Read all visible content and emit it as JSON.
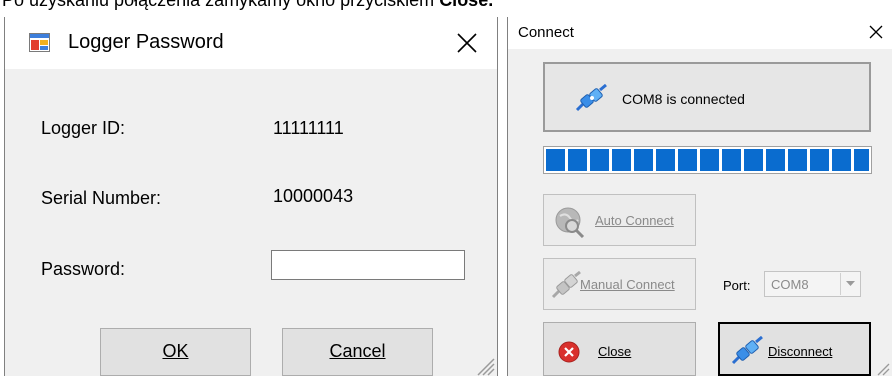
{
  "caption": {
    "text": "Po uzyskaniu połączenia zamykamy okno przyciskiem ",
    "bold": "Close."
  },
  "logger_dialog": {
    "title": "Logger Password",
    "logger_id_label": "Logger ID:",
    "logger_id_value": "11111111",
    "serial_label": "Serial Number:",
    "serial_value": "10000043",
    "password_label": "Password:",
    "password_value": "",
    "ok_label": "OK",
    "cancel_label": "Cancel"
  },
  "connect_dialog": {
    "title": "Connect",
    "status_text": "COM8 is connected",
    "progress_fraction": 1.0,
    "auto_connect_label": "Auto Connect",
    "manual_connect_label": "Manual Connect",
    "port_label": "Port:",
    "port_value": "COM8",
    "close_label": "Close",
    "disconnect_label": "Disconnect"
  },
  "colors": {
    "progress": "#0a6ccf",
    "dialog_bg": "#f0f0f0",
    "close_red": "#d9302c"
  }
}
